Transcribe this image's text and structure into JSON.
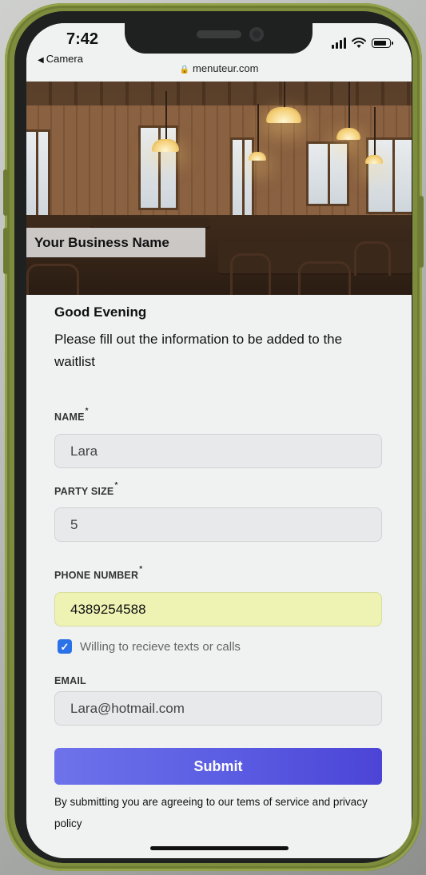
{
  "status_bar": {
    "time": "7:42",
    "back_label": "Camera",
    "url": "menuteur.com",
    "icons": [
      "signal-icon",
      "wifi-icon",
      "battery-icon"
    ]
  },
  "hero": {
    "business_name": "Your Business Name"
  },
  "form": {
    "greeting": "Good Evening",
    "intro": "Please fill out the information to be added to the waitlist",
    "name_label": "NAME",
    "name_value": "Lara",
    "party_label": "PARTY SIZE",
    "party_value": "5",
    "phone_label": "PHONE NUMBER",
    "phone_value": "4389254588",
    "required_marker": "*",
    "consent_label": "Willing to recieve texts or calls",
    "consent_checked": true,
    "email_label": "EMAIL",
    "email_value": "Lara@hotmail.com",
    "submit_label": "Submit",
    "terms_text": "By submitting you are agreeing to our tems of service and privacy policy"
  },
  "colors": {
    "phone_frame": "#7e8d3d",
    "accent_button_start": "#6e72ea",
    "accent_button_end": "#4c44d6",
    "phone_field_bg": "#eef3b4",
    "checkbox": "#2b71e8"
  }
}
